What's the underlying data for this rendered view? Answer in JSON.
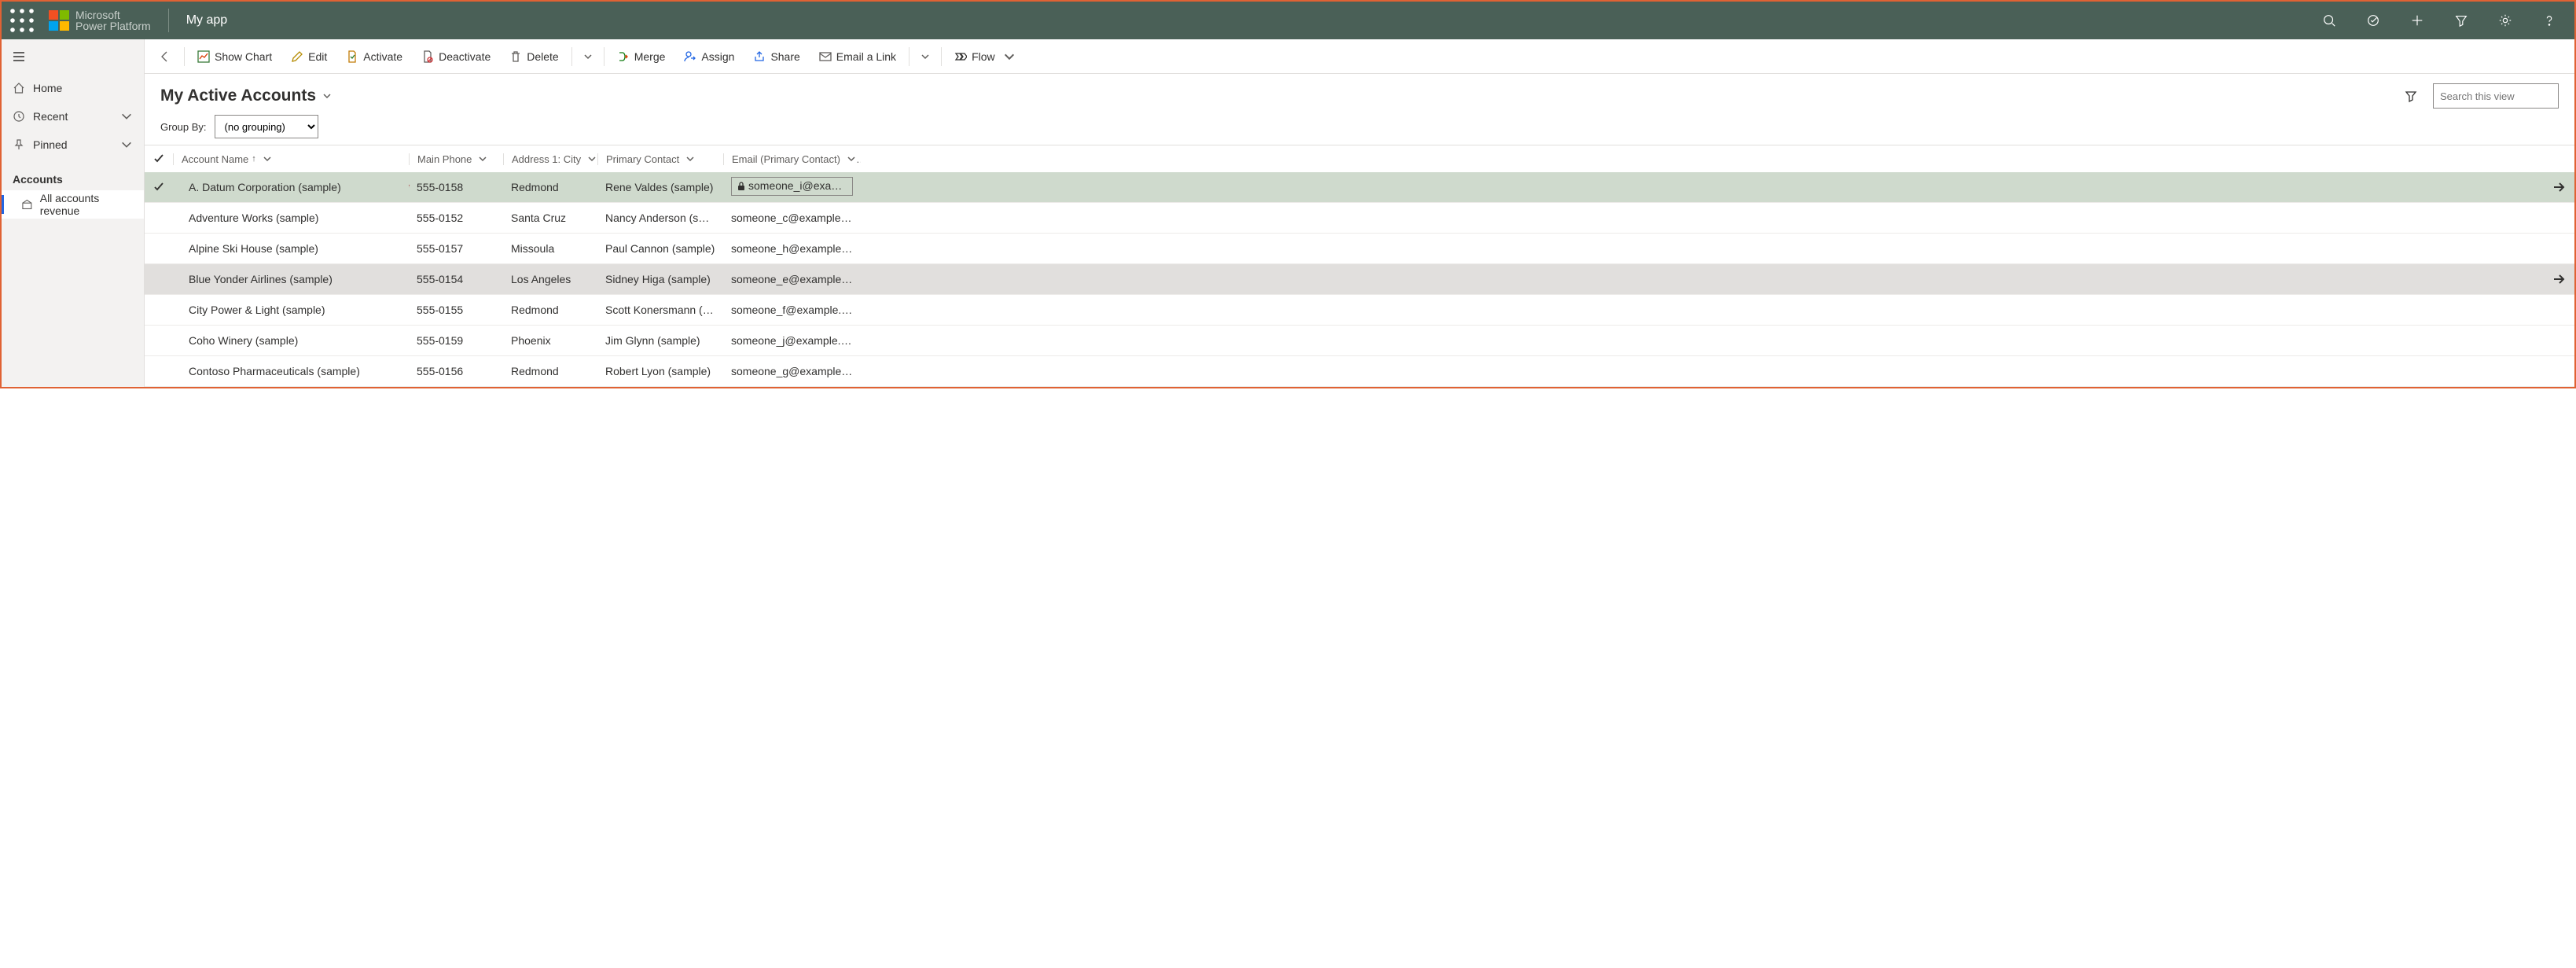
{
  "brand": {
    "line1": "Microsoft",
    "line2": "Power Platform"
  },
  "app_name": "My app",
  "sidebar": {
    "home": "Home",
    "recent": "Recent",
    "pinned": "Pinned",
    "group_label": "Accounts",
    "subitem": "All accounts revenue"
  },
  "commands": {
    "show_chart": "Show Chart",
    "edit": "Edit",
    "activate": "Activate",
    "deactivate": "Deactivate",
    "delete": "Delete",
    "merge": "Merge",
    "assign": "Assign",
    "share": "Share",
    "email_link": "Email a Link",
    "flow": "Flow"
  },
  "view": {
    "title": "My Active Accounts",
    "search_placeholder": "Search this view"
  },
  "groupby": {
    "label": "Group By:",
    "selected": "(no grouping)"
  },
  "columns": {
    "name": "Account Name",
    "phone": "Main Phone",
    "city": "Address 1: City",
    "contact": "Primary Contact",
    "email": "Email (Primary Contact)"
  },
  "rows": [
    {
      "name": "A. Datum Corporation (sample)",
      "phone": "555-0158",
      "city": "Redmond",
      "contact": "Rene Valdes (sample)",
      "email": "someone_i@examp…",
      "selected": true,
      "required": true,
      "locked": true
    },
    {
      "name": "Adventure Works (sample)",
      "phone": "555-0152",
      "city": "Santa Cruz",
      "contact": "Nancy Anderson (sam…",
      "email": "someone_c@example.…"
    },
    {
      "name": "Alpine Ski House (sample)",
      "phone": "555-0157",
      "city": "Missoula",
      "contact": "Paul Cannon (sample)",
      "email": "someone_h@example.…"
    },
    {
      "name": "Blue Yonder Airlines (sample)",
      "phone": "555-0154",
      "city": "Los Angeles",
      "contact": "Sidney Higa (sample)",
      "email": "someone_e@example.…",
      "hover": true
    },
    {
      "name": "City Power & Light (sample)",
      "phone": "555-0155",
      "city": "Redmond",
      "contact": "Scott Konersmann (sa…",
      "email": "someone_f@example.…"
    },
    {
      "name": "Coho Winery (sample)",
      "phone": "555-0159",
      "city": "Phoenix",
      "contact": "Jim Glynn (sample)",
      "email": "someone_j@example.c…"
    },
    {
      "name": "Contoso Pharmaceuticals (sample)",
      "phone": "555-0156",
      "city": "Redmond",
      "contact": "Robert Lyon (sample)",
      "email": "someone_g@example.…"
    }
  ]
}
